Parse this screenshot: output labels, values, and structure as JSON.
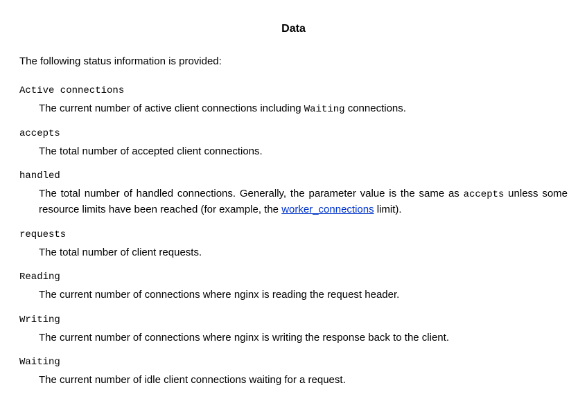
{
  "heading": "Data",
  "intro": "The following status information is provided:",
  "items": [
    {
      "term": "Active connections",
      "desc_pre": "The current number of active client connections including ",
      "mono1": "Waiting",
      "desc_post": " connections."
    },
    {
      "term": "accepts",
      "desc": "The total number of accepted client connections."
    },
    {
      "term": "handled",
      "desc_pre": "The total number of handled connections. Generally, the parameter value is the same as ",
      "mono1": "accepts",
      "desc_mid": " unless some resource limits have been reached (for example, the ",
      "link": "worker_connections",
      "desc_post": " limit)."
    },
    {
      "term": "requests",
      "desc": "The total number of client requests."
    },
    {
      "term": "Reading",
      "desc": "The current number of connections where nginx is reading the request header."
    },
    {
      "term": "Writing",
      "desc": "The current number of connections where nginx is writing the response back to the client."
    },
    {
      "term": "Waiting",
      "desc": "The current number of idle client connections waiting for a request."
    }
  ]
}
